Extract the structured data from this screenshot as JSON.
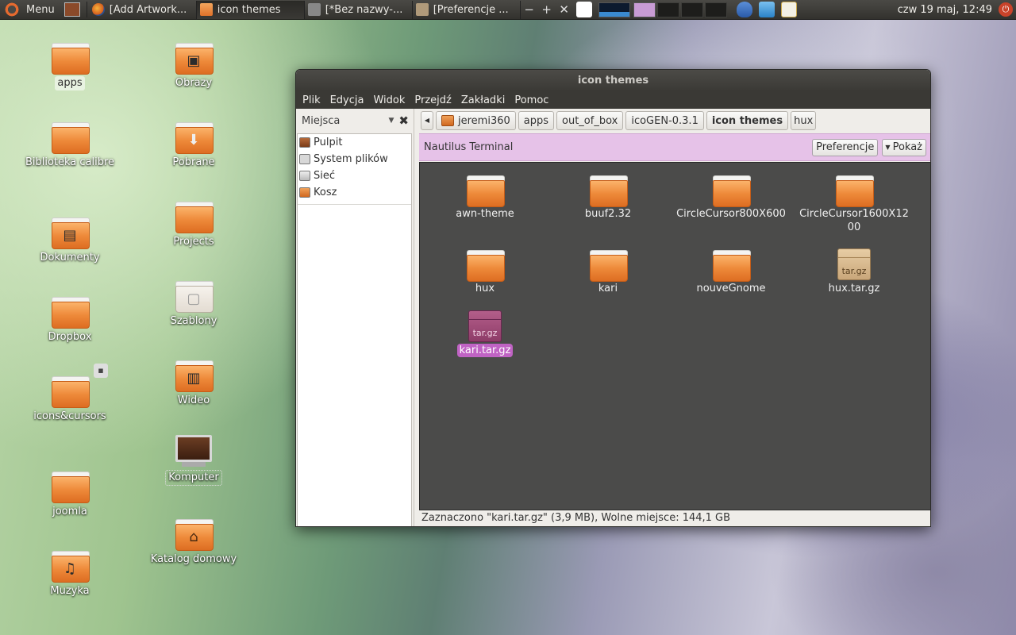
{
  "panel": {
    "menu_label": "Menu",
    "tasks": [
      {
        "label": "[Add  Artwork...",
        "icon": "firefox-icon"
      },
      {
        "label": "icon themes",
        "icon": "folder-icon"
      },
      {
        "label": "[*Bez nazwy-...",
        "icon": "gimp-icon"
      },
      {
        "label": "[Preferencje ...",
        "icon": "preferences-icon"
      }
    ],
    "tray_buttons": [
      "−",
      "+",
      "✕"
    ],
    "clock": "czw 19 maj, 12:49"
  },
  "desktop": {
    "icons": [
      {
        "label": "apps",
        "type": "folder"
      },
      {
        "label": "Obrazy",
        "type": "folder-pictures"
      },
      {
        "label": "Biblioteka calibre",
        "type": "folder"
      },
      {
        "label": "Pobrane",
        "type": "folder-download"
      },
      {
        "label": "Dokumenty",
        "type": "folder-documents"
      },
      {
        "label": "Projects",
        "type": "folder"
      },
      {
        "label": "Dropbox",
        "type": "folder"
      },
      {
        "label": "Szablony",
        "type": "folder-templates"
      },
      {
        "label": "icons&cursors",
        "type": "folder-link"
      },
      {
        "label": "Wideo",
        "type": "folder-video"
      },
      {
        "label": "Komputer",
        "type": "computer"
      },
      {
        "label": "joomla",
        "type": "folder"
      },
      {
        "label": "Katalog domowy",
        "type": "folder-home"
      },
      {
        "label": "Muzyka",
        "type": "folder-music"
      }
    ]
  },
  "window": {
    "title": "icon themes",
    "menus": [
      "Plik",
      "Edycja",
      "Widok",
      "Przejdź",
      "Zakładki",
      "Pomoc"
    ],
    "sidebar": {
      "title": "Miejsca",
      "places": [
        "Pulpit",
        "System plików",
        "Sieć",
        "Kosz"
      ]
    },
    "path": [
      "jeremi360",
      "apps",
      "out_of_box",
      "icoGEN-0.3.1",
      "icon themes",
      "hux"
    ],
    "extension_bar": {
      "label": "Nautilus Terminal",
      "pref_button": "Preferencje",
      "show_button": "Pokaż"
    },
    "files": [
      {
        "name": "awn-theme",
        "type": "folder"
      },
      {
        "name": "buuf2.32",
        "type": "folder"
      },
      {
        "name": "CircleCursor800X600",
        "type": "folder"
      },
      {
        "name": "CircleCursor1600X1200",
        "type": "folder"
      },
      {
        "name": "hux",
        "type": "folder"
      },
      {
        "name": "kari",
        "type": "folder"
      },
      {
        "name": "nouveGnome",
        "type": "folder"
      },
      {
        "name": "hux.tar.gz",
        "type": "archive",
        "badge": "tar.gz"
      },
      {
        "name": "kari.tar.gz",
        "type": "archive",
        "badge": "tar.gz",
        "selected": true
      }
    ],
    "status": "Zaznaczono \"kari.tar.gz\" (3,9 MB), Wolne miejsce: 144,1 GB"
  }
}
